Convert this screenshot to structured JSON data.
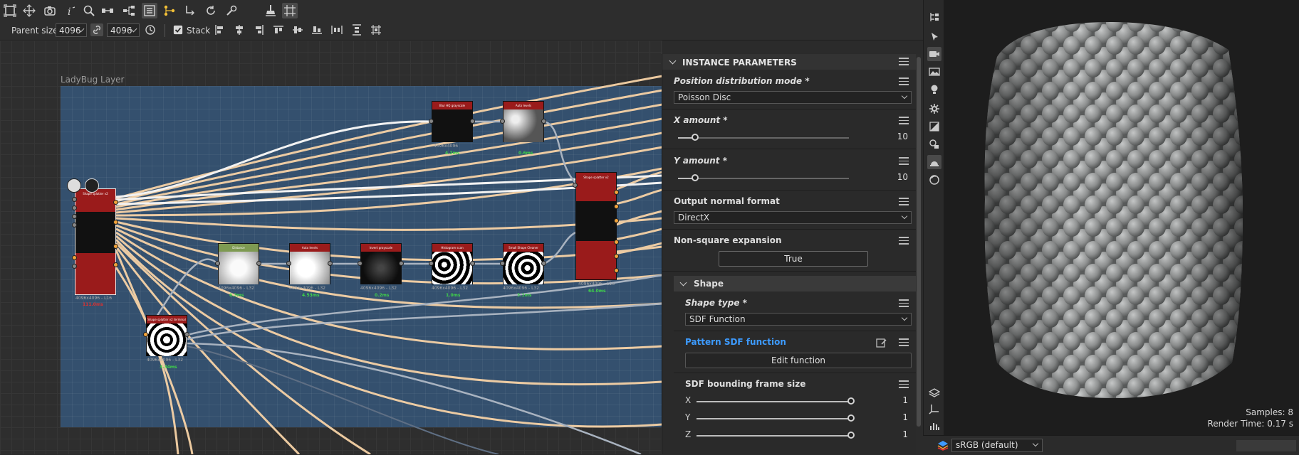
{
  "toolbar": {
    "parent_size_label": "Parent size:",
    "parent_size_width": "4096",
    "parent_size_height": "4096",
    "stack_label": "Stack"
  },
  "graph": {
    "layer_title": "LadyBug Layer",
    "nodes": [
      {
        "title": "Shape splatter v2",
        "meta": "4096x4096 - L16",
        "time": "111.0ms",
        "time_color": "#e0302f",
        "head": "#9a1b1b"
      },
      {
        "title": "Blur HQ grayscale",
        "meta": "4096x4096",
        "time": "4.2ms",
        "time_color": "#3fd24a",
        "head": "#9a1b1b"
      },
      {
        "title": "Auto levels",
        "meta": "4096x4096",
        "time": "0.6ms",
        "time_color": "#3fd24a",
        "head": "#9a1b1b"
      },
      {
        "title": "Distance",
        "meta": "4096x4096 - L32",
        "time": "6.3ms",
        "time_color": "#3fd24a",
        "head": "#7e9a52"
      },
      {
        "title": "Auto levels",
        "meta": "4096x4096 - L32",
        "time": "4.53ms",
        "time_color": "#3fd24a",
        "head": "#9a1b1b"
      },
      {
        "title": "Invert grayscale",
        "meta": "4096x4096 - L32",
        "time": "0.2ms",
        "time_color": "#3fd24a",
        "head": "#9a1b1b"
      },
      {
        "title": "Histogram scan",
        "meta": "4096x4096 - L32",
        "time": "1.0ms",
        "time_color": "#3fd24a",
        "head": "#9a1b1b"
      },
      {
        "title": "Small Shape Cleaner",
        "meta": "4096x4096 - L32",
        "time": "3.1ms",
        "time_color": "#3fd24a",
        "head": "#9a1b1b"
      },
      {
        "title": "Shape splatter v2",
        "meta": "4096x4096 - L16",
        "time": "64.0ms",
        "time_color": "#3fd24a",
        "head": "#9a1b1b"
      },
      {
        "title": "Shape splatter v2 terminal",
        "meta": "4096x4096 - L32",
        "time": "3.34ms",
        "time_color": "#3fd24a",
        "head": "#9a1b1b"
      }
    ]
  },
  "panel": {
    "title": "INSTANCE PARAMETERS",
    "position_label": "Position distribution mode *",
    "position_value": "Poisson Disc",
    "x_amount_label": "X amount *",
    "x_amount_value": "10",
    "x_amount_fraction": 0.1,
    "y_amount_label": "Y amount *",
    "y_amount_value": "10",
    "y_amount_fraction": 0.1,
    "normal_label": "Output normal format",
    "normal_value": "DirectX",
    "nonsquare_label": "Non-square expansion",
    "nonsquare_value": "True",
    "shape_section": "Shape",
    "shape_type_label": "Shape type *",
    "shape_type_value": "SDF Function",
    "pattern_label": "Pattern SDF function",
    "edit_function_label": "Edit function",
    "bounding_label": "SDF bounding frame size",
    "axes": [
      {
        "name": "X",
        "value": "1"
      },
      {
        "name": "Y",
        "value": "1"
      },
      {
        "name": "Z",
        "value": "1"
      }
    ]
  },
  "viewport": {
    "samples": "Samples: 8",
    "render_time": "Render Time: 0.17 s",
    "colorspace": "sRGB (default)"
  },
  "colors": {
    "accent_blue": "#3d9bff",
    "node_red": "#9a1b1b",
    "wire_orange": "#f6d2a6",
    "layer_blue": "#34506e"
  }
}
